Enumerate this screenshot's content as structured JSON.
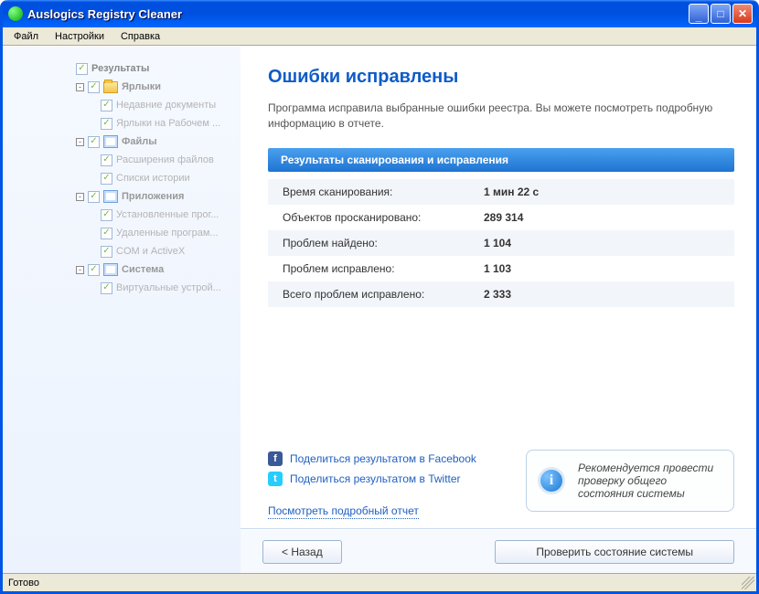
{
  "window": {
    "title": "Auslogics Registry Cleaner"
  },
  "menu": {
    "file": "Файл",
    "settings": "Настройки",
    "help": "Справка"
  },
  "tree": {
    "root": "Результаты",
    "groups": [
      {
        "label": "Ярлыки",
        "items": [
          "Недавние документы",
          "Ярлыки на Рабочем ..."
        ]
      },
      {
        "label": "Файлы",
        "items": [
          "Расширения файлов",
          "Списки истории"
        ]
      },
      {
        "label": "Приложения",
        "items": [
          "Установленные прог...",
          "Удаленные програм...",
          "COM и ActiveX"
        ]
      },
      {
        "label": "Система",
        "items": [
          "Виртуальные устрой..."
        ]
      }
    ]
  },
  "page": {
    "heading": "Ошибки исправлены",
    "description": "Программа исправила выбранные ошибки реестра. Вы можете посмотреть подробную информацию в отчете.",
    "section_header": "Результаты сканирования и исправления",
    "rows": [
      {
        "k": "Время сканирования:",
        "v": "1 мин 22 с"
      },
      {
        "k": "Объектов просканировано:",
        "v": "289 314"
      },
      {
        "k": "Проблем найдено:",
        "v": "1 104"
      },
      {
        "k": "Проблем исправлено:",
        "v": "1 103"
      },
      {
        "k": "Всего проблем исправлено:",
        "v": "2 333"
      }
    ],
    "share_fb": "Поделиться результатом в Facebook",
    "share_tw": "Поделиться результатом в Twitter",
    "report_link": "Посмотреть подробный отчет",
    "callout": "Рекомендуется провести проверку общего состояния системы"
  },
  "buttons": {
    "back": "< Назад",
    "check": "Проверить состояние системы"
  },
  "status": "Готово"
}
